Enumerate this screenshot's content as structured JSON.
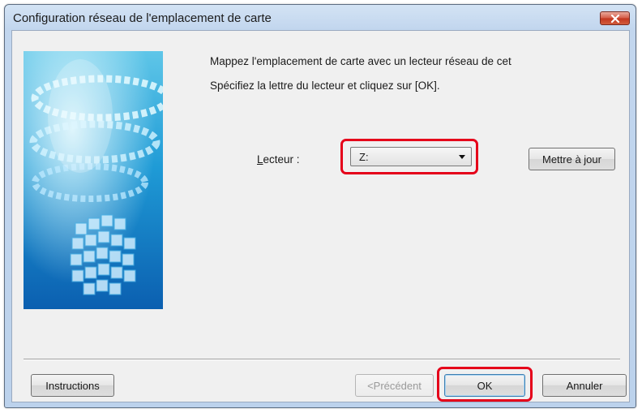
{
  "window": {
    "title": "Configuration réseau de l'emplacement de carte",
    "close_icon": "close-icon"
  },
  "message": {
    "line1": "Mappez l'emplacement de carte avec un lecteur réseau de cet",
    "line2": "Spécifiez la lettre du lecteur et cliquez sur [OK]."
  },
  "drive": {
    "label_accel": "L",
    "label_rest": "ecteur :",
    "value": "Z:"
  },
  "buttons": {
    "update": "Mettre à jour",
    "instructions": "Instructions",
    "previous": "<Précédent",
    "ok": "OK",
    "cancel": "Annuler"
  },
  "colors": {
    "highlight": "#e5001a",
    "titlebar": "#c2d6ee",
    "client_bg": "#f0f0f0"
  }
}
